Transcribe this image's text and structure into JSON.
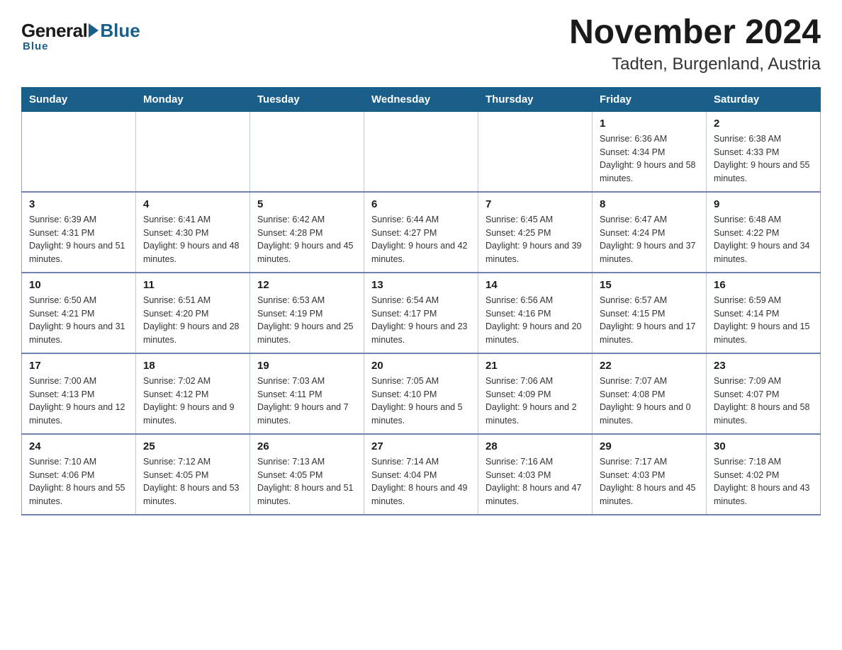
{
  "logo": {
    "general": "General",
    "blue": "Blue",
    "subtitle": "Blue"
  },
  "header": {
    "month_year": "November 2024",
    "location": "Tadten, Burgenland, Austria"
  },
  "weekdays": [
    "Sunday",
    "Monday",
    "Tuesday",
    "Wednesday",
    "Thursday",
    "Friday",
    "Saturday"
  ],
  "weeks": [
    [
      {
        "day": "",
        "info": ""
      },
      {
        "day": "",
        "info": ""
      },
      {
        "day": "",
        "info": ""
      },
      {
        "day": "",
        "info": ""
      },
      {
        "day": "",
        "info": ""
      },
      {
        "day": "1",
        "info": "Sunrise: 6:36 AM\nSunset: 4:34 PM\nDaylight: 9 hours and 58 minutes."
      },
      {
        "day": "2",
        "info": "Sunrise: 6:38 AM\nSunset: 4:33 PM\nDaylight: 9 hours and 55 minutes."
      }
    ],
    [
      {
        "day": "3",
        "info": "Sunrise: 6:39 AM\nSunset: 4:31 PM\nDaylight: 9 hours and 51 minutes."
      },
      {
        "day": "4",
        "info": "Sunrise: 6:41 AM\nSunset: 4:30 PM\nDaylight: 9 hours and 48 minutes."
      },
      {
        "day": "5",
        "info": "Sunrise: 6:42 AM\nSunset: 4:28 PM\nDaylight: 9 hours and 45 minutes."
      },
      {
        "day": "6",
        "info": "Sunrise: 6:44 AM\nSunset: 4:27 PM\nDaylight: 9 hours and 42 minutes."
      },
      {
        "day": "7",
        "info": "Sunrise: 6:45 AM\nSunset: 4:25 PM\nDaylight: 9 hours and 39 minutes."
      },
      {
        "day": "8",
        "info": "Sunrise: 6:47 AM\nSunset: 4:24 PM\nDaylight: 9 hours and 37 minutes."
      },
      {
        "day": "9",
        "info": "Sunrise: 6:48 AM\nSunset: 4:22 PM\nDaylight: 9 hours and 34 minutes."
      }
    ],
    [
      {
        "day": "10",
        "info": "Sunrise: 6:50 AM\nSunset: 4:21 PM\nDaylight: 9 hours and 31 minutes."
      },
      {
        "day": "11",
        "info": "Sunrise: 6:51 AM\nSunset: 4:20 PM\nDaylight: 9 hours and 28 minutes."
      },
      {
        "day": "12",
        "info": "Sunrise: 6:53 AM\nSunset: 4:19 PM\nDaylight: 9 hours and 25 minutes."
      },
      {
        "day": "13",
        "info": "Sunrise: 6:54 AM\nSunset: 4:17 PM\nDaylight: 9 hours and 23 minutes."
      },
      {
        "day": "14",
        "info": "Sunrise: 6:56 AM\nSunset: 4:16 PM\nDaylight: 9 hours and 20 minutes."
      },
      {
        "day": "15",
        "info": "Sunrise: 6:57 AM\nSunset: 4:15 PM\nDaylight: 9 hours and 17 minutes."
      },
      {
        "day": "16",
        "info": "Sunrise: 6:59 AM\nSunset: 4:14 PM\nDaylight: 9 hours and 15 minutes."
      }
    ],
    [
      {
        "day": "17",
        "info": "Sunrise: 7:00 AM\nSunset: 4:13 PM\nDaylight: 9 hours and 12 minutes."
      },
      {
        "day": "18",
        "info": "Sunrise: 7:02 AM\nSunset: 4:12 PM\nDaylight: 9 hours and 9 minutes."
      },
      {
        "day": "19",
        "info": "Sunrise: 7:03 AM\nSunset: 4:11 PM\nDaylight: 9 hours and 7 minutes."
      },
      {
        "day": "20",
        "info": "Sunrise: 7:05 AM\nSunset: 4:10 PM\nDaylight: 9 hours and 5 minutes."
      },
      {
        "day": "21",
        "info": "Sunrise: 7:06 AM\nSunset: 4:09 PM\nDaylight: 9 hours and 2 minutes."
      },
      {
        "day": "22",
        "info": "Sunrise: 7:07 AM\nSunset: 4:08 PM\nDaylight: 9 hours and 0 minutes."
      },
      {
        "day": "23",
        "info": "Sunrise: 7:09 AM\nSunset: 4:07 PM\nDaylight: 8 hours and 58 minutes."
      }
    ],
    [
      {
        "day": "24",
        "info": "Sunrise: 7:10 AM\nSunset: 4:06 PM\nDaylight: 8 hours and 55 minutes."
      },
      {
        "day": "25",
        "info": "Sunrise: 7:12 AM\nSunset: 4:05 PM\nDaylight: 8 hours and 53 minutes."
      },
      {
        "day": "26",
        "info": "Sunrise: 7:13 AM\nSunset: 4:05 PM\nDaylight: 8 hours and 51 minutes."
      },
      {
        "day": "27",
        "info": "Sunrise: 7:14 AM\nSunset: 4:04 PM\nDaylight: 8 hours and 49 minutes."
      },
      {
        "day": "28",
        "info": "Sunrise: 7:16 AM\nSunset: 4:03 PM\nDaylight: 8 hours and 47 minutes."
      },
      {
        "day": "29",
        "info": "Sunrise: 7:17 AM\nSunset: 4:03 PM\nDaylight: 8 hours and 45 minutes."
      },
      {
        "day": "30",
        "info": "Sunrise: 7:18 AM\nSunset: 4:02 PM\nDaylight: 8 hours and 43 minutes."
      }
    ]
  ]
}
